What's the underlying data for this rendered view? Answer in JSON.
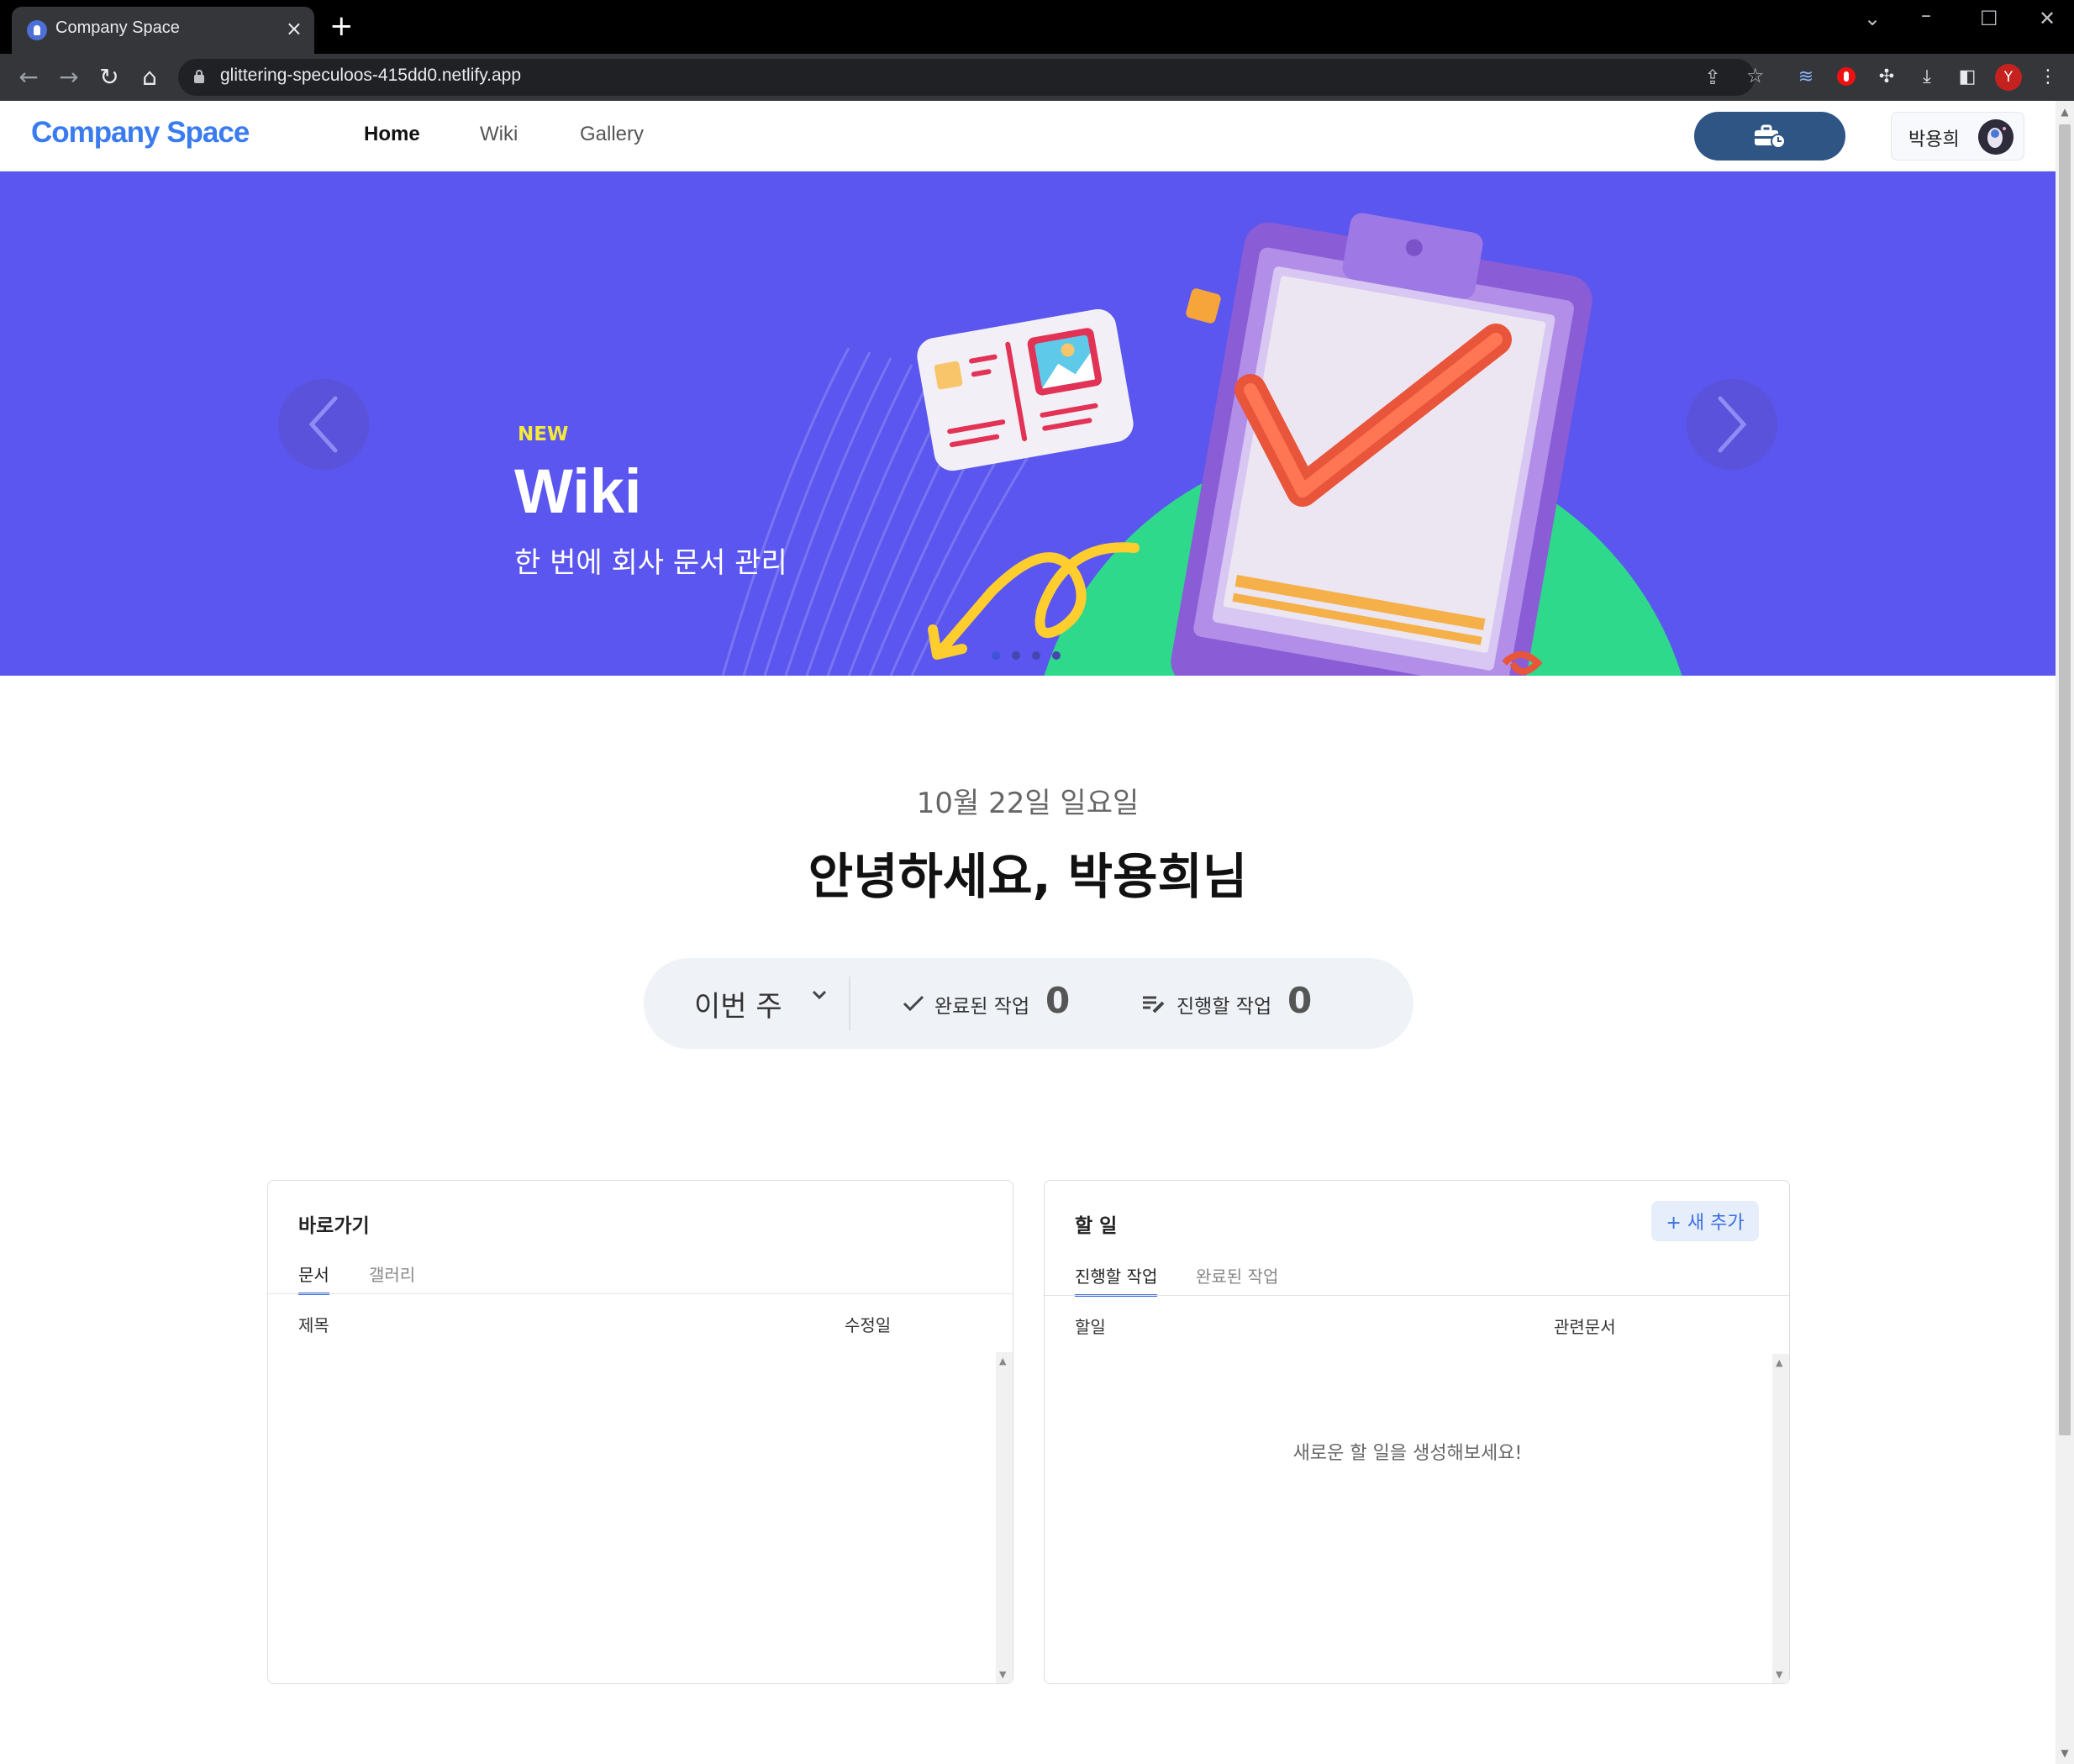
{
  "browser": {
    "tab_title": "Company Space",
    "url": "glittering-speculoos-415dd0.netlify.app",
    "profile_initial": "Y"
  },
  "header": {
    "logo": "Company Space",
    "nav": [
      {
        "label": "Home",
        "active": true
      },
      {
        "label": "Wiki",
        "active": false
      },
      {
        "label": "Gallery",
        "active": false
      }
    ],
    "user_name": "박용희"
  },
  "hero": {
    "badge": "NEW",
    "title": "Wiki",
    "subtitle": "한 번에 회사 문서 관리",
    "slide_count": 4,
    "active_slide": 1,
    "colors": {
      "background": "#5b56ef",
      "circle": "#2fd98c",
      "badge": "#f4ea3c"
    }
  },
  "greeting": {
    "date": "10월 22일 일요일",
    "message": "안녕하세요, 박용희님"
  },
  "stats": {
    "period": "이번 주",
    "completed_label": "완료된 작업",
    "completed_value": "0",
    "todo_label": "진행할 작업",
    "todo_value": "0"
  },
  "shortcuts": {
    "title": "바로가기",
    "tabs": [
      "문서",
      "갤러리"
    ],
    "columns": [
      "제목",
      "수정일"
    ]
  },
  "todos": {
    "title": "할 일",
    "add_label": "+ 새 추가",
    "tabs": [
      "진행할 작업",
      "완료된 작업"
    ],
    "columns": [
      "할일",
      "관련문서"
    ],
    "empty_message": "새로운 할 일을 생성해보세요!"
  },
  "accent_color": "#3a7bf0"
}
